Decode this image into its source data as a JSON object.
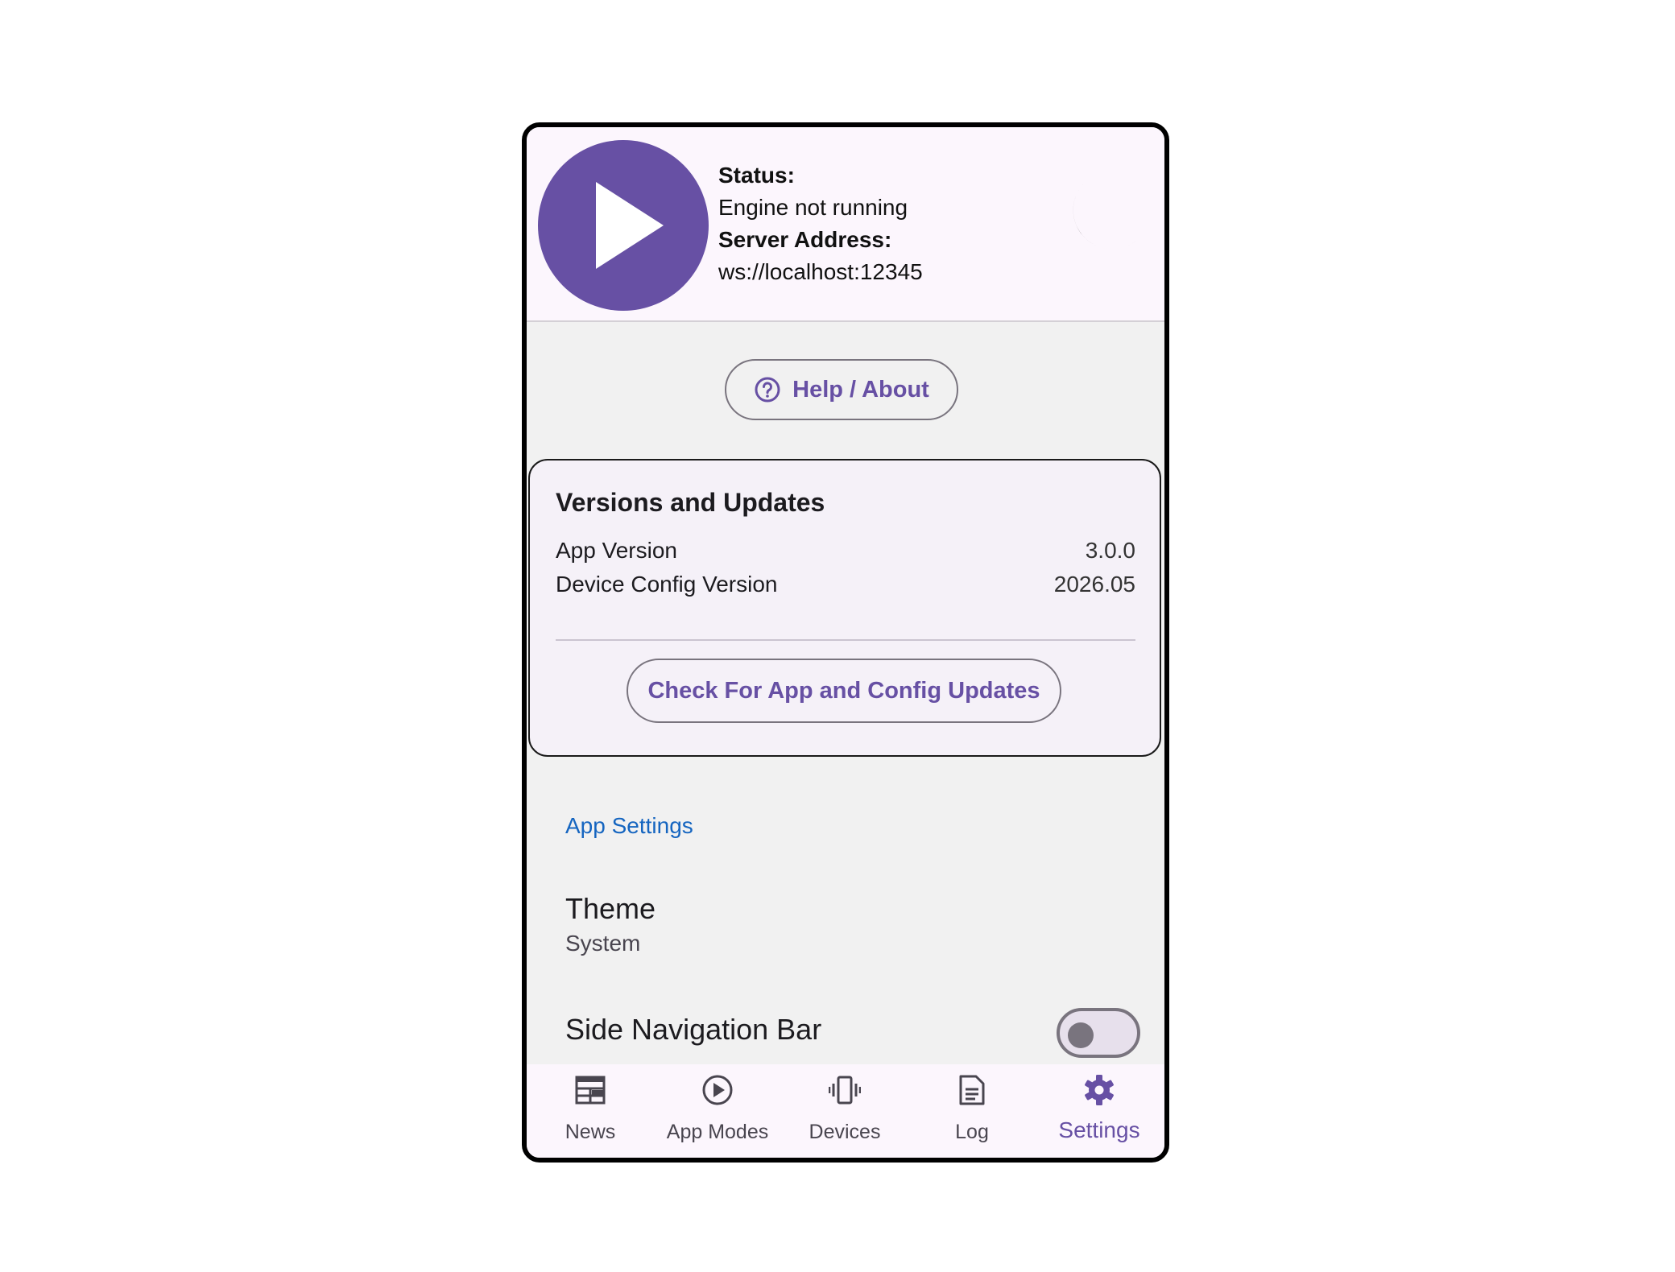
{
  "header": {
    "status_label": "Status:",
    "status_value": "Engine not running",
    "server_label": "Server Address:",
    "server_value": "ws://localhost:12345",
    "play_icon": "play-icon",
    "theme_icon": "moon-icon"
  },
  "help": {
    "label": "Help / About",
    "icon": "help-circle-icon"
  },
  "versions": {
    "title": "Versions and Updates",
    "app_version_label": "App Version",
    "app_version_value": "3.0.0",
    "config_version_label": "Device Config Version",
    "config_version_value": "2026.05",
    "update_button": "Check For App and Config Updates"
  },
  "settings": {
    "section_title": "App Settings",
    "theme_title": "Theme",
    "theme_value": "System",
    "side_nav_title": "Side Navigation Bar",
    "side_nav_enabled": false
  },
  "nav": {
    "items": [
      {
        "label": "News",
        "icon": "news-icon",
        "active": false
      },
      {
        "label": "App Modes",
        "icon": "play-circle-icon",
        "active": false
      },
      {
        "label": "Devices",
        "icon": "vibration-icon",
        "active": false
      },
      {
        "label": "Log",
        "icon": "document-icon",
        "active": false
      },
      {
        "label": "Settings",
        "icon": "gear-icon",
        "active": true
      }
    ]
  },
  "colors": {
    "primary": "#6750a4",
    "link": "#1565c0",
    "header_bg": "#fcf6fd",
    "page_bg": "#f1f1f1"
  }
}
